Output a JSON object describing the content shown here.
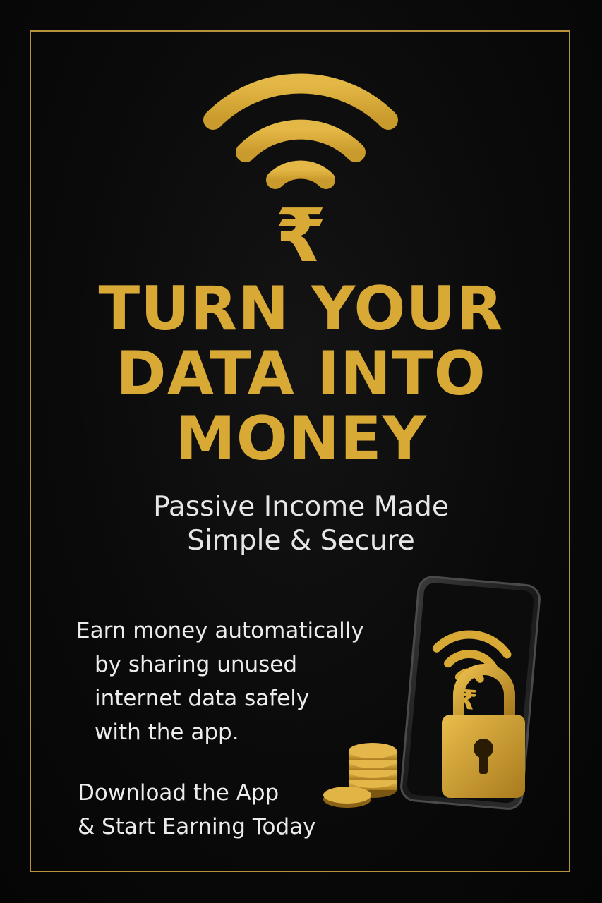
{
  "headline": {
    "line1": "TURN YOUR",
    "line2": "DATA INTO",
    "line3": "MONEY"
  },
  "subhead": {
    "line1": "Passive Income Made",
    "line2": "Simple & Secure"
  },
  "body": {
    "line1": "Earn money automatically",
    "line2": "by sharing unused",
    "line3": "internet data safely",
    "line4": "with the app."
  },
  "cta": {
    "line1": "Download the App",
    "line2": "& Start Earning Today"
  },
  "logo": {
    "icon": "wifi-rupee-icon",
    "symbol": "₹"
  },
  "phone_logo": {
    "symbol": "₹"
  },
  "colors": {
    "gold": "#d9a935",
    "background": "#070707",
    "text": "#ececec"
  }
}
